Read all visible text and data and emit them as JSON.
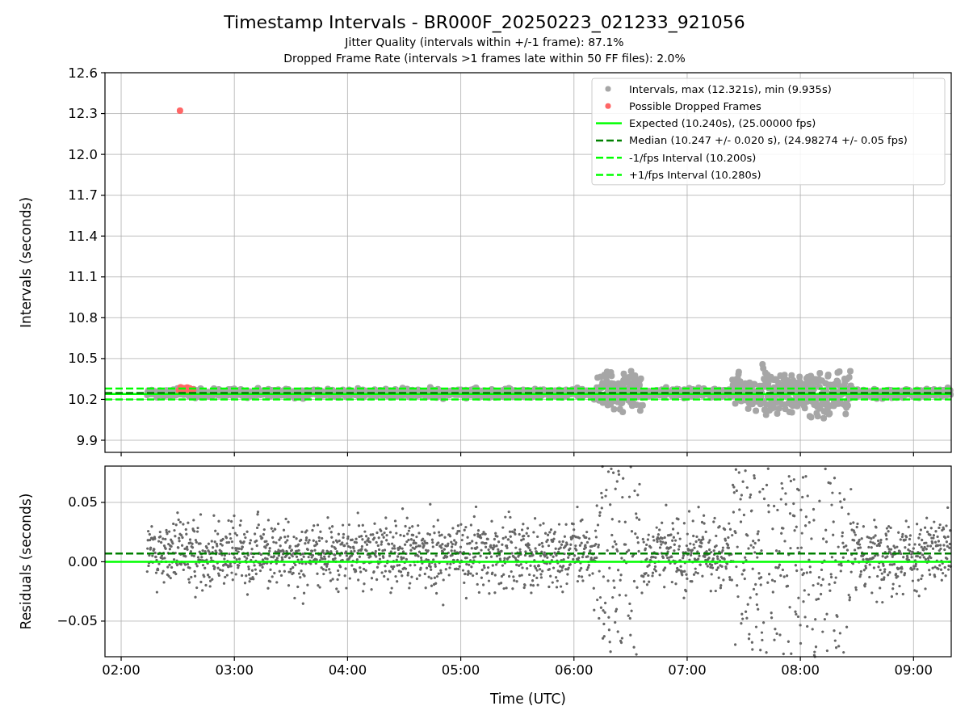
{
  "figure": {
    "title": "Timestamp Intervals - BR000F_20250223_021233_921056",
    "subtitles": [
      "Jitter Quality (intervals within +/-1 frame): 87.1%",
      "Dropped Frame Rate (intervals >1 frames late within 50 FF files): 2.0%"
    ]
  },
  "charts": [
    {
      "kind": "intervals",
      "marker_legend": [
        {
          "label": "Intervals, max (12.321s), min (9.935s)",
          "color": "#a6a6a6"
        },
        {
          "label": "Possible Dropped Frames",
          "color": "#ff6666"
        }
      ],
      "chart_data": {
        "type": "scatter",
        "grid": true,
        "legend": "upper right",
        "ylabel": "Intervals (seconds)",
        "xlim": [
          1.857,
          9.333
        ],
        "ylim": [
          9.811,
          12.6
        ],
        "yticks": [
          {
            "value": 9.9,
            "label": "9.9"
          },
          {
            "value": 10.2,
            "label": "10.2"
          },
          {
            "value": 10.5,
            "label": "10.5"
          },
          {
            "value": 10.8,
            "label": "10.8"
          },
          {
            "value": 11.1,
            "label": "11.1"
          },
          {
            "value": 11.4,
            "label": "11.4"
          },
          {
            "value": 11.7,
            "label": "11.7"
          },
          {
            "value": 12.0,
            "label": "12.0"
          },
          {
            "value": 12.3,
            "label": "12.3"
          },
          {
            "value": 12.6,
            "label": "12.6"
          }
        ],
        "ref_lines": [
          {
            "axis": "y",
            "value": 10.24,
            "label": "Expected (10.240s), (25.00000 fps)",
            "color": "#00ff00",
            "line_style": "solid"
          },
          {
            "axis": "y",
            "value": 10.247,
            "label": "Median (10.247 +/- 0.020 s), (24.98274 +/- 0.05 fps)",
            "color": "#008000",
            "line_style": "dashed"
          },
          {
            "axis": "y",
            "value": 10.2,
            "label": "-1/fps Interval (10.200s)",
            "color": "#00ff00",
            "line_style": "dashed"
          },
          {
            "axis": "y",
            "value": 10.28,
            "label": "+1/fps Interval (10.280s)",
            "color": "#00ff00",
            "line_style": "dashed"
          }
        ]
      }
    },
    {
      "kind": "residuals",
      "chart_data": {
        "type": "scatter",
        "grid": true,
        "xlabel": "Time (UTC)",
        "ylabel": "Residuals (seconds)",
        "xlim": [
          1.857,
          9.333
        ],
        "ylim": [
          -0.08,
          0.0806
        ],
        "xticks": [
          {
            "value": 2,
            "label": "02:00"
          },
          {
            "value": 3,
            "label": "03:00"
          },
          {
            "value": 4,
            "label": "04:00"
          },
          {
            "value": 5,
            "label": "05:00"
          },
          {
            "value": 6,
            "label": "06:00"
          },
          {
            "value": 7,
            "label": "07:00"
          },
          {
            "value": 8,
            "label": "08:00"
          },
          {
            "value": 9,
            "label": "09:00"
          }
        ],
        "yticks": [
          {
            "value": -0.05,
            "label": "−0.05"
          },
          {
            "value": 0,
            "label": "0.00"
          },
          {
            "value": 0.05,
            "label": "0.05"
          }
        ],
        "ref_lines": [
          {
            "axis": "y",
            "value": 0,
            "color": "#00ff00",
            "line_style": "solid"
          },
          {
            "axis": "y",
            "value": 0.007,
            "color": "#008000",
            "line_style": "dashed"
          }
        ]
      }
    }
  ]
}
